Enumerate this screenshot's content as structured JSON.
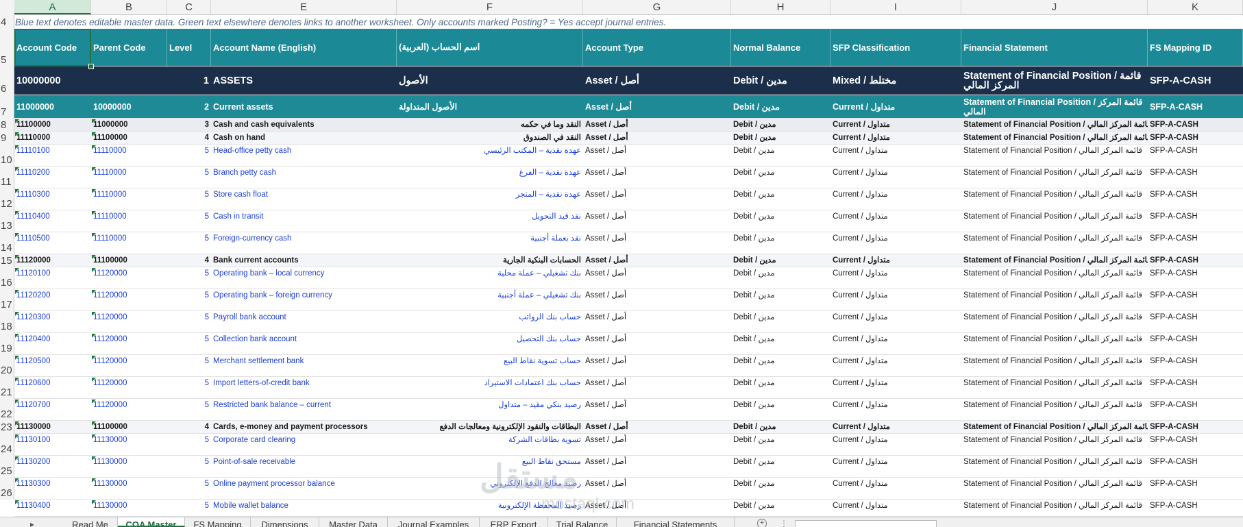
{
  "columns": [
    "A",
    "B",
    "C",
    "E",
    "F",
    "G",
    "H",
    "I",
    "J",
    "K"
  ],
  "row_numbers": [
    "4",
    "5",
    "6",
    "7",
    "8",
    "9",
    "10",
    "11",
    "12",
    "13",
    "14",
    "15",
    "16",
    "17",
    "18",
    "19",
    "20",
    "21",
    "22",
    "23",
    "24",
    "25",
    "26"
  ],
  "note": "Blue text denotes editable master data. Green text elsewhere denotes links to another worksheet. Only accounts marked Posting? = Yes accept journal entries.",
  "headers": {
    "account_code": "Account Code",
    "parent_code": "Parent Code",
    "level": "Level",
    "account_name_en": "Account Name (English)",
    "account_name_ar": "اسم الحساب (العربية)",
    "account_type": "Account Type",
    "normal_balance": "Normal Balance",
    "sfp_classification": "SFP Classification",
    "financial_statement": "Financial Statement",
    "fs_mapping_id": "FS Mapping ID"
  },
  "rows": [
    {
      "code": "10000000",
      "parent": "",
      "level": "1",
      "name": "ASSETS",
      "name_ar": "الأصول",
      "type": "Asset / أصل",
      "balance": "Debit / مدين",
      "sfp": "Mixed / مختلط",
      "fs": "Statement of Financial Position / قائمة المركز المالي",
      "fsid": "SFP-A-CASH"
    },
    {
      "code": "11000000",
      "parent": "10000000",
      "level": "2",
      "name": "Current assets",
      "name_ar": "الأصول المتداولة",
      "type": "Asset / أصل",
      "balance": "Debit / مدين",
      "sfp": "Current / متداول",
      "fs": "Statement of Financial Position / قائمة المركز المالي",
      "fsid": "SFP-A-CASH"
    },
    {
      "code": "11100000",
      "parent": "11000000",
      "level": "3",
      "name": "Cash and cash equivalents",
      "name_ar": "النقد وما في حكمه",
      "type": "Asset / أصل",
      "balance": "Debit / مدين",
      "sfp": "Current / متداول",
      "fs": "Statement of Financial Position / قائمة المركز المالي",
      "fsid": "SFP-A-CASH"
    },
    {
      "code": "11110000",
      "parent": "11100000",
      "level": "4",
      "name": "Cash on hand",
      "name_ar": "النقد في الصندوق",
      "type": "Asset / أصل",
      "balance": "Debit / مدين",
      "sfp": "Current / متداول",
      "fs": "Statement of Financial Position / قائمة المركز المالي",
      "fsid": "SFP-A-CASH"
    },
    {
      "code": "11110100",
      "parent": "11110000",
      "level": "5",
      "name": "Head-office petty cash",
      "name_ar": "عهدة نقدية – المكتب الرئيسي",
      "type": "Asset / أصل",
      "balance": "Debit / مدين",
      "sfp": "Current / متداول",
      "fs": "Statement of Financial Position / قائمة المركز المالي",
      "fsid": "SFP-A-CASH"
    },
    {
      "code": "11110200",
      "parent": "11110000",
      "level": "5",
      "name": "Branch petty cash",
      "name_ar": "عهدة نقدية – الفرع",
      "type": "Asset / أصل",
      "balance": "Debit / مدين",
      "sfp": "Current / متداول",
      "fs": "Statement of Financial Position / قائمة المركز المالي",
      "fsid": "SFP-A-CASH"
    },
    {
      "code": "11110300",
      "parent": "11110000",
      "level": "5",
      "name": "Store cash float",
      "name_ar": "عهدة نقدية – المتجر",
      "type": "Asset / أصل",
      "balance": "Debit / مدين",
      "sfp": "Current / متداول",
      "fs": "Statement of Financial Position / قائمة المركز المالي",
      "fsid": "SFP-A-CASH"
    },
    {
      "code": "11110400",
      "parent": "11110000",
      "level": "5",
      "name": "Cash in transit",
      "name_ar": "نقد قيد التحويل",
      "type": "Asset / أصل",
      "balance": "Debit / مدين",
      "sfp": "Current / متداول",
      "fs": "Statement of Financial Position / قائمة المركز المالي",
      "fsid": "SFP-A-CASH"
    },
    {
      "code": "11110500",
      "parent": "11110000",
      "level": "5",
      "name": "Foreign-currency cash",
      "name_ar": "نقد بعملة أجنبية",
      "type": "Asset / أصل",
      "balance": "Debit / مدين",
      "sfp": "Current / متداول",
      "fs": "Statement of Financial Position / قائمة المركز المالي",
      "fsid": "SFP-A-CASH"
    },
    {
      "code": "11120000",
      "parent": "11100000",
      "level": "4",
      "name": "Bank current accounts",
      "name_ar": "الحسابات البنكية الجارية",
      "type": "Asset / أصل",
      "balance": "Debit / مدين",
      "sfp": "Current / متداول",
      "fs": "Statement of Financial Position / قائمة المركز المالي",
      "fsid": "SFP-A-CASH"
    },
    {
      "code": "11120100",
      "parent": "11120000",
      "level": "5",
      "name": "Operating bank – local currency",
      "name_ar": "بنك تشغيلي – عملة محلية",
      "type": "Asset / أصل",
      "balance": "Debit / مدين",
      "sfp": "Current / متداول",
      "fs": "Statement of Financial Position / قائمة المركز المالي",
      "fsid": "SFP-A-CASH"
    },
    {
      "code": "11120200",
      "parent": "11120000",
      "level": "5",
      "name": "Operating bank – foreign currency",
      "name_ar": "بنك تشغيلي – عملة أجنبية",
      "type": "Asset / أصل",
      "balance": "Debit / مدين",
      "sfp": "Current / متداول",
      "fs": "Statement of Financial Position / قائمة المركز المالي",
      "fsid": "SFP-A-CASH"
    },
    {
      "code": "11120300",
      "parent": "11120000",
      "level": "5",
      "name": "Payroll bank account",
      "name_ar": "حساب بنك الرواتب",
      "type": "Asset / أصل",
      "balance": "Debit / مدين",
      "sfp": "Current / متداول",
      "fs": "Statement of Financial Position / قائمة المركز المالي",
      "fsid": "SFP-A-CASH"
    },
    {
      "code": "11120400",
      "parent": "11120000",
      "level": "5",
      "name": "Collection bank account",
      "name_ar": "حساب بنك التحصيل",
      "type": "Asset / أصل",
      "balance": "Debit / مدين",
      "sfp": "Current / متداول",
      "fs": "Statement of Financial Position / قائمة المركز المالي",
      "fsid": "SFP-A-CASH"
    },
    {
      "code": "11120500",
      "parent": "11120000",
      "level": "5",
      "name": "Merchant settlement bank",
      "name_ar": "حساب تسوية نقاط البيع",
      "type": "Asset / أصل",
      "balance": "Debit / مدين",
      "sfp": "Current / متداول",
      "fs": "Statement of Financial Position / قائمة المركز المالي",
      "fsid": "SFP-A-CASH"
    },
    {
      "code": "11120600",
      "parent": "11120000",
      "level": "5",
      "name": "Import letters-of-credit bank",
      "name_ar": "حساب بنك اعتمادات الاستيراد",
      "type": "Asset / أصل",
      "balance": "Debit / مدين",
      "sfp": "Current / متداول",
      "fs": "Statement of Financial Position / قائمة المركز المالي",
      "fsid": "SFP-A-CASH"
    },
    {
      "code": "11120700",
      "parent": "11120000",
      "level": "5",
      "name": "Restricted bank balance – current",
      "name_ar": "رصيد بنكي مقيد – متداول",
      "type": "Asset / أصل",
      "balance": "Debit / مدين",
      "sfp": "Current / متداول",
      "fs": "Statement of Financial Position / قائمة المركز المالي",
      "fsid": "SFP-A-CASH"
    },
    {
      "code": "11130000",
      "parent": "11100000",
      "level": "4",
      "name": "Cards, e-money and payment processors",
      "name_ar": "البطاقات والنقود الإلكترونية ومعالجات الدفع",
      "type": "Asset / أصل",
      "balance": "Debit / مدين",
      "sfp": "Current / متداول",
      "fs": "Statement of Financial Position / قائمة المركز المالي",
      "fsid": "SFP-A-CASH"
    },
    {
      "code": "11130100",
      "parent": "11130000",
      "level": "5",
      "name": "Corporate card clearing",
      "name_ar": "تسوية بطاقات الشركة",
      "type": "Asset / أصل",
      "balance": "Debit / مدين",
      "sfp": "Current / متداول",
      "fs": "Statement of Financial Position / قائمة المركز المالي",
      "fsid": "SFP-A-CASH"
    },
    {
      "code": "11130200",
      "parent": "11130000",
      "level": "5",
      "name": "Point-of-sale receivable",
      "name_ar": "مستحق نقاط البيع",
      "type": "Asset / أصل",
      "balance": "Debit / مدين",
      "sfp": "Current / متداول",
      "fs": "Statement of Financial Position / قائمة المركز المالي",
      "fsid": "SFP-A-CASH"
    },
    {
      "code": "11130300",
      "parent": "11130000",
      "level": "5",
      "name": "Online payment processor balance",
      "name_ar": "رصيد معالج الدفع الإلكتروني",
      "type": "Asset / أصل",
      "balance": "Debit / مدين",
      "sfp": "Current / متداول",
      "fs": "Statement of Financial Position / قائمة المركز المالي",
      "fsid": "SFP-A-CASH"
    },
    {
      "code": "11130400",
      "parent": "11130000",
      "level": "5",
      "name": "Mobile wallet balance",
      "name_ar": "رصيد المحفظة الإلكترونية",
      "type": "Asset / أصل",
      "balance": "Debit / مدين",
      "sfp": "Current / متداول",
      "fs": "Statement of Financial Position / قائمة المركز المالي",
      "fsid": "SFP-A-CASH"
    }
  ],
  "watermark": {
    "arabic": "مستقل",
    "latin": "mostaql.com"
  },
  "sheet_tabs": [
    "Read Me",
    "COA Master",
    "FS Mapping",
    "Dimensions",
    "Master Data",
    "Journal Examples",
    "ERP Export",
    "Trial Balance",
    "Financial Statements"
  ],
  "active_tab": "COA Master",
  "colors": {
    "header_teal": "#1b8a96",
    "level1_navy": "#1b2e4a",
    "level2_teal": "#1e8a95",
    "editable_blue": "#1a3fd6",
    "selection_green": "#217346"
  }
}
